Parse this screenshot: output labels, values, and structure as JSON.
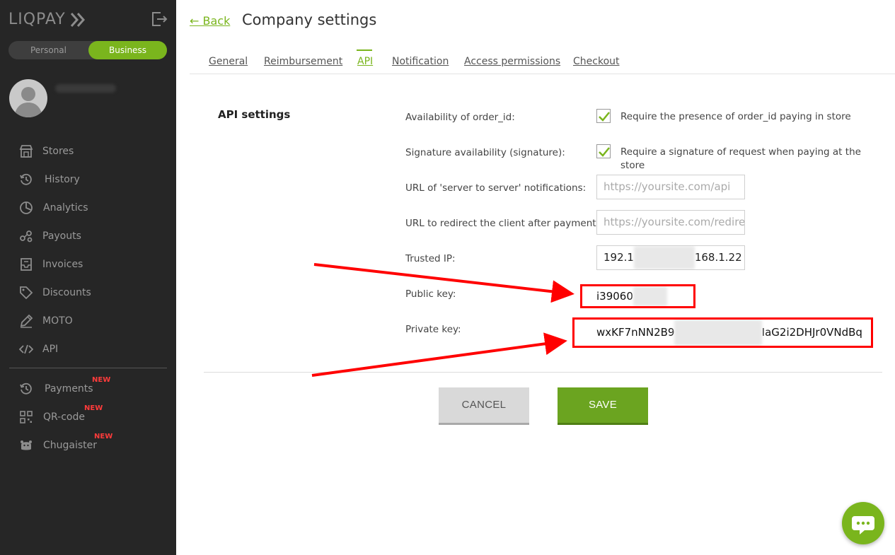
{
  "sidebar": {
    "logo_text": "LIQPAY",
    "account_switch": {
      "personal": "Personal",
      "business": "Business",
      "selected": "Business"
    },
    "items": [
      {
        "label": "Stores",
        "icon": "store-icon"
      },
      {
        "label": "History",
        "icon": "history-icon"
      },
      {
        "label": "Analytics",
        "icon": "pie-chart-icon"
      },
      {
        "label": "Payouts",
        "icon": "payouts-icon"
      },
      {
        "label": "Invoices",
        "icon": "invoice-icon"
      },
      {
        "label": "Discounts",
        "icon": "tag-icon"
      },
      {
        "label": "MOTO",
        "icon": "pen-icon"
      },
      {
        "label": "API",
        "icon": "code-icon"
      }
    ],
    "extra_items": [
      {
        "label": "Payments",
        "badge": "NEW",
        "icon": "history-icon"
      },
      {
        "label": "QR-code",
        "badge": "NEW",
        "icon": "qr-code-icon"
      },
      {
        "label": "Chugaister",
        "badge": "NEW",
        "icon": "chugaister-icon"
      }
    ]
  },
  "header": {
    "back_label": "← Back",
    "title": "Company settings"
  },
  "tabs": [
    {
      "label": "General",
      "active": false
    },
    {
      "label": "Reimbursement",
      "active": false
    },
    {
      "label": "API",
      "active": true
    },
    {
      "label": "Notification",
      "active": false
    },
    {
      "label": "Access permissions",
      "active": false
    },
    {
      "label": "Checkout",
      "active": false
    }
  ],
  "api_settings": {
    "section_title": "API settings",
    "order_id": {
      "label": "Availability of order_id:",
      "checked": true,
      "text": "Require the presence of order_id paying in store"
    },
    "signature": {
      "label": "Signature availability (signature):",
      "checked": true,
      "text": "Require a signature of request when paying at the store"
    },
    "server_url": {
      "label": "URL of 'server to server' notifications:",
      "placeholder": "https://yoursite.com/api"
    },
    "redirect_url": {
      "label": "URL to redirect the client after payment:",
      "placeholder": "https://yoursite.com/redirect"
    },
    "trusted_ip": {
      "label": "Trusted IP:",
      "value_visible_start": "192.1",
      "value_visible_end": "168.1.22"
    },
    "public_key": {
      "label": "Public key:",
      "value_visible": "i39060"
    },
    "private_key": {
      "label": "Private key:",
      "value_visible_start": "wxKF7nNN2B9",
      "value_visible_end": "IaG2i2DHJr0VNdBq"
    }
  },
  "actions": {
    "cancel": "CANCEL",
    "save": "SAVE"
  },
  "colors": {
    "accent": "#7ab51d",
    "sidebar_bg": "#262626",
    "annotation": "#ff0000",
    "new_badge": "#ff3b3b"
  }
}
